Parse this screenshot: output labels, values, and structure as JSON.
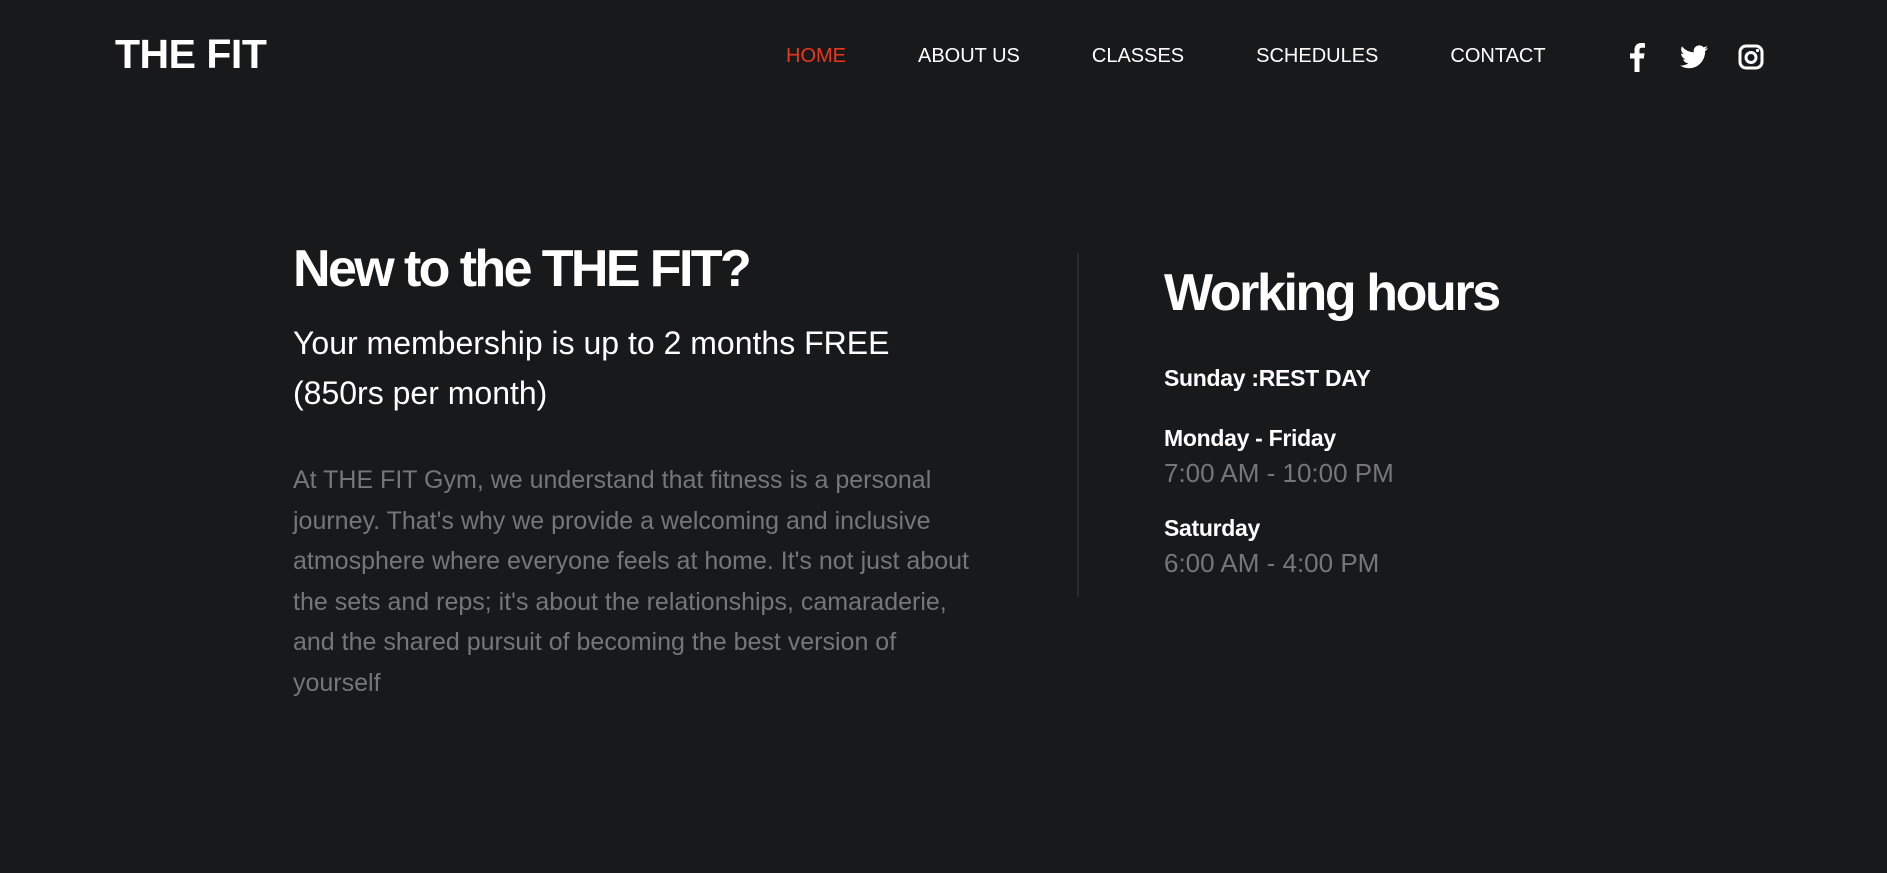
{
  "brand": {
    "logo": "THE FIT",
    "accent_color": "#e8381f",
    "background_color": "#18191b",
    "muted_text_color": "#75767a"
  },
  "nav": {
    "items": [
      {
        "label": "HOME",
        "active": true
      },
      {
        "label": "ABOUT US",
        "active": false
      },
      {
        "label": "CLASSES",
        "active": false
      },
      {
        "label": "SCHEDULES",
        "active": false
      },
      {
        "label": "CONTACT",
        "active": false
      }
    ]
  },
  "social": {
    "icons": [
      "facebook-icon",
      "twitter-icon",
      "instagram-icon"
    ]
  },
  "intro": {
    "title": "New to the THE FIT?",
    "subtitle": "Your membership is up to 2 months FREE (850rs per month)",
    "body": "At THE FIT Gym, we understand that fitness is a personal journey. That's why we provide a welcoming and inclusive atmosphere where everyone feels at home. It's not just about the sets and reps; it's about the relationships, camaraderie, and the shared pursuit of becoming the best version of yourself"
  },
  "hours": {
    "title": "Working hours",
    "entries": [
      {
        "day": "Sunday :REST DAY",
        "time": ""
      },
      {
        "day": "Monday - Friday",
        "time": "7:00 AM - 10:00 PM"
      },
      {
        "day": "Saturday",
        "time": "6:00 AM - 4:00 PM"
      }
    ]
  }
}
